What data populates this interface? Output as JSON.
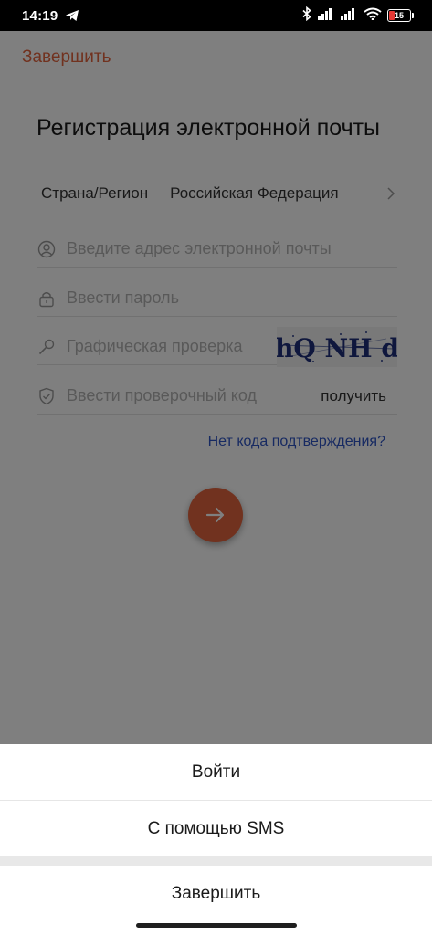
{
  "status_bar": {
    "time": "14:19",
    "telegram_icon": "telegram-icon",
    "bluetooth_icon": "bluetooth-icon",
    "signal_icon": "signal-icon",
    "wifi_icon": "wifi-icon",
    "battery_level": "15"
  },
  "header": {
    "finish_link": "Завершить",
    "title": "Регистрация электронной почты"
  },
  "region": {
    "label": "Страна/Регион",
    "value": "Российская Федерация",
    "chevron_icon": "chevron-right-icon"
  },
  "form": {
    "email_placeholder": "Введите адрес электронной почты",
    "email_icon": "user-icon",
    "password_placeholder": "Ввести пароль",
    "password_icon": "lock-icon",
    "captcha_placeholder": "Графическая проверка",
    "captcha_icon": "key-icon",
    "captcha_text": "hQ NH d",
    "code_placeholder": "Ввести проверочный код",
    "code_icon": "shield-check-icon",
    "get_code_label": "получить",
    "no_code_link": "Нет кода подтверждения?",
    "next_icon": "arrow-right-icon"
  },
  "action_sheet": {
    "login": "Войти",
    "sms": "С помощью SMS",
    "cancel": "Завершить"
  },
  "colors": {
    "accent": "#e2643f",
    "link": "#2f55c4",
    "battery_alert": "#e53935"
  }
}
